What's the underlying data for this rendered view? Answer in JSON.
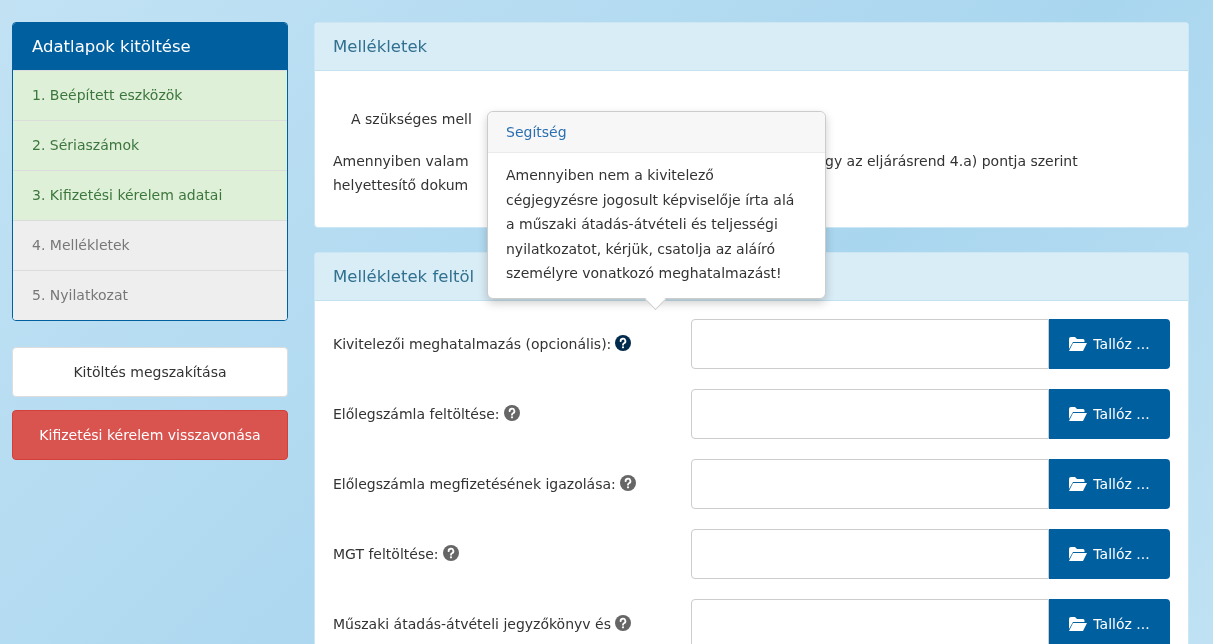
{
  "sidebar": {
    "title": "Adatlapok kitöltése",
    "items": [
      {
        "label": "1. Beépített eszközök",
        "done": true
      },
      {
        "label": "2. Sériaszámok",
        "done": true
      },
      {
        "label": "3. Kifizetési kérelem adatai",
        "done": true
      },
      {
        "label": "4. Mellékletek",
        "done": false
      },
      {
        "label": "5. Nyilatkozat",
        "done": false
      }
    ],
    "buttons": [
      {
        "label": "Kitöltés megszakítása",
        "kind": "default"
      },
      {
        "label": "Kifizetési kérelem visszavonása",
        "kind": "danger"
      }
    ]
  },
  "info_panel": {
    "title": "Mellékletek",
    "line_1": "A szükséges mell",
    "line_2_left": "Amennyiben valam",
    "line_2_right": "gy az eljárásrend 4.a) pontja szerint",
    "line_3_left": "helyettesítő dokum"
  },
  "upload_panel": {
    "title": "Mellékletek feltöl",
    "rows": [
      {
        "label": "Kivitelezői meghatalmazás (opcionális):",
        "help_active": true,
        "button": "Tallóz ..."
      },
      {
        "label": "Előlegszámla feltöltése:",
        "help_active": false,
        "button": "Tallóz ..."
      },
      {
        "label": "Előlegszámla megfizetésének igazolása:",
        "help_active": false,
        "button": "Tallóz ..."
      },
      {
        "label": "MGT feltöltése:",
        "help_active": false,
        "button": "Tallóz ..."
      },
      {
        "label": "Műszaki átadás-átvételi jegyzőkönyv és",
        "help_active": false,
        "button": "Tallóz ..."
      }
    ]
  },
  "tooltip": {
    "title": "Segítség",
    "text": "Amennyiben nem a kivitelező cégjegyzésre jogosult képviselője írta alá a műszaki átadás-átvételi és teljességi nyilatkozatot, kérjük, csatolja az aláíró személyre vonatkozó meghatalmazást!"
  }
}
